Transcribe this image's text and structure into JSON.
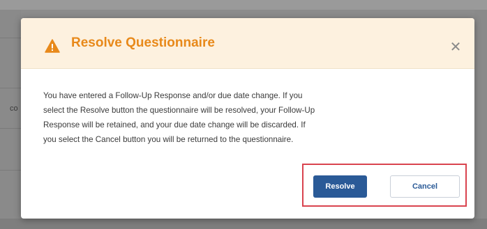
{
  "background": {
    "left_fragment": "co"
  },
  "dialog": {
    "title": "Resolve Questionnaire",
    "close_glyph": "✕",
    "message_lines": [
      "You have entered a Follow-Up Response and/or due date change. If you",
      "select the Resolve button the questionnaire will be resolved, your Follow-Up",
      "Response will be retained, and your due date change will be discarded. If",
      "you select the Cancel button you will be returned to the questionnaire."
    ],
    "buttons": {
      "resolve_label": "Resolve",
      "cancel_label": "Cancel"
    },
    "icons": {
      "title_icon": "warning-icon",
      "close_icon": "close-icon"
    }
  },
  "colors": {
    "title": "#e8891a",
    "header_bg": "#fdf1df",
    "primary_button": "#2a5a97",
    "highlight_border": "#d9434e"
  }
}
